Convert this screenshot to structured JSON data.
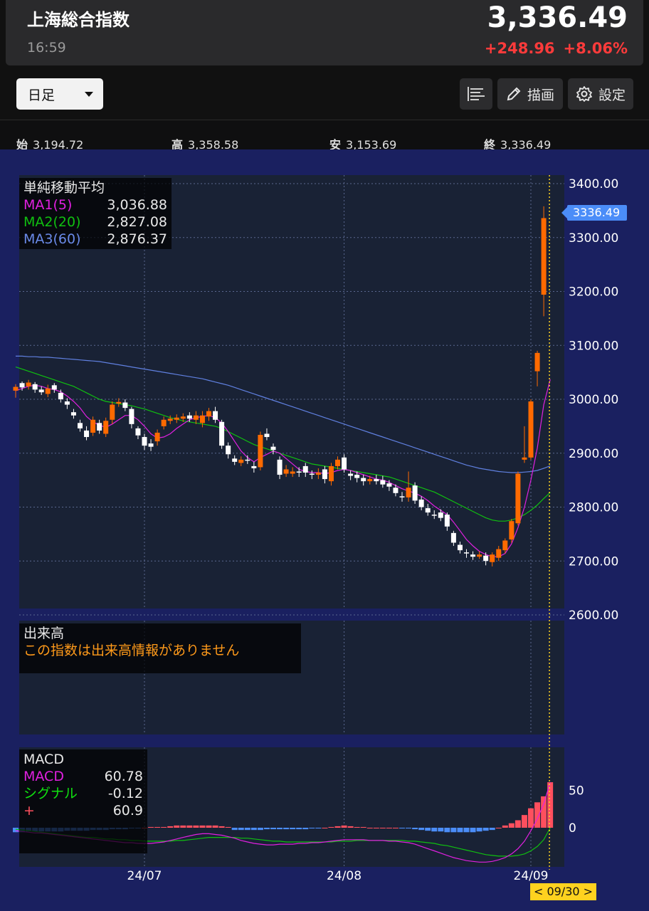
{
  "header": {
    "title": "上海総合指数",
    "time": "16:59",
    "price": "3,336.49",
    "change": "+248.96",
    "change_pct": "+8.06%"
  },
  "toolbar": {
    "period": "日足",
    "draw_label": "描画",
    "settings_label": "設定"
  },
  "ohlc": {
    "open_label": "始",
    "open": "3,194.72",
    "high_label": "高",
    "high": "3,358.58",
    "low_label": "安",
    "low": "3,153.69",
    "close_label": "終",
    "close": "3,336.49"
  },
  "ma_legend": {
    "title": "単純移動平均",
    "ma1_label": "MA1(5)",
    "ma1_value": "3,036.88",
    "ma2_label": "MA2(20)",
    "ma2_value": "2,827.08",
    "ma3_label": "MA3(60)",
    "ma3_value": "2,876.37"
  },
  "volume_legend": {
    "title": "出来高",
    "message": "この指数は出来高情報がありません"
  },
  "macd_legend": {
    "title": "MACD",
    "macd_label": "MACD",
    "macd_value": "60.78",
    "signal_label": "シグナル",
    "signal_value": "-0.12",
    "hist_label": "+",
    "hist_value": "60.9"
  },
  "current_price_tag": "3336.49",
  "date_tag": "< 09/30 >",
  "colors": {
    "up": "#ff6a00",
    "down": "#ffffff",
    "ma1": "#e020e0",
    "ma2": "#10c010",
    "ma3": "#6080e0",
    "macd_pos": "#ff4f5e",
    "macd_neg": "#4b8df8",
    "background": "#1a2060",
    "panel": "#192235"
  },
  "chart_data": {
    "type": "candlestick",
    "y_ticks": [
      "3400.00",
      "3300.00",
      "3200.00",
      "3100.00",
      "3000.00",
      "2900.00",
      "2800.00",
      "2700.00",
      "2600.00"
    ],
    "ylim": [
      2600,
      3400
    ],
    "x_ticks": [
      {
        "label": "24/07",
        "index": 20
      },
      {
        "label": "24/08",
        "index": 51
      },
      {
        "label": "24/09",
        "index": 80
      }
    ],
    "macd_ticks": [
      "50",
      "0"
    ],
    "candles": [
      [
        3016,
        3023,
        3028,
        3003
      ],
      [
        3030,
        3022,
        3033,
        3016
      ],
      [
        3024,
        3031,
        3036,
        3018
      ],
      [
        3028,
        3018,
        3032,
        3012
      ],
      [
        3018,
        3013,
        3024,
        3008
      ],
      [
        3010,
        3020,
        3027,
        3004
      ],
      [
        3026,
        3018,
        3030,
        3012
      ],
      [
        3012,
        3000,
        3018,
        2994
      ],
      [
        2996,
        2990,
        3002,
        2982
      ],
      [
        2976,
        2970,
        2982,
        2964
      ],
      [
        2956,
        2946,
        2962,
        2940
      ],
      [
        2942,
        2930,
        2950,
        2924
      ],
      [
        2938,
        2962,
        2968,
        2932
      ],
      [
        2956,
        2942,
        2962,
        2936
      ],
      [
        2936,
        2960,
        2966,
        2930
      ],
      [
        2962,
        2990,
        2996,
        2954
      ],
      [
        2992,
        2995,
        3002,
        2986
      ],
      [
        2994,
        2984,
        3000,
        2978
      ],
      [
        2982,
        2954,
        2986,
        2946
      ],
      [
        2946,
        2933,
        2950,
        2926
      ],
      [
        2930,
        2914,
        2936,
        2906
      ],
      [
        2918,
        2912,
        2926,
        2904
      ],
      [
        2922,
        2938,
        2944,
        2914
      ],
      [
        2950,
        2962,
        2968,
        2944
      ],
      [
        2960,
        2964,
        2970,
        2954
      ],
      [
        2962,
        2966,
        2972,
        2956
      ],
      [
        2964,
        2968,
        2974,
        2958
      ],
      [
        2970,
        2964,
        2976,
        2958
      ],
      [
        2962,
        2970,
        2978,
        2954
      ],
      [
        2956,
        2970,
        2978,
        2948
      ],
      [
        2968,
        2978,
        2984,
        2960
      ],
      [
        2978,
        2962,
        2986,
        2956
      ],
      [
        2958,
        2914,
        2962,
        2908
      ],
      [
        2914,
        2898,
        2920,
        2890
      ],
      [
        2890,
        2884,
        2896,
        2878
      ],
      [
        2882,
        2888,
        2894,
        2876
      ],
      [
        2888,
        2886,
        2896,
        2880
      ],
      [
        2876,
        2872,
        2884,
        2864
      ],
      [
        2874,
        2934,
        2940,
        2868
      ],
      [
        2936,
        2930,
        2946,
        2924
      ],
      [
        2912,
        2906,
        2918,
        2898
      ],
      [
        2888,
        2860,
        2894,
        2852
      ],
      [
        2862,
        2870,
        2878,
        2856
      ],
      [
        2862,
        2866,
        2874,
        2856
      ],
      [
        2866,
        2864,
        2874,
        2856
      ],
      [
        2876,
        2864,
        2882,
        2856
      ],
      [
        2862,
        2860,
        2868,
        2852
      ],
      [
        2860,
        2864,
        2872,
        2852
      ],
      [
        2870,
        2852,
        2876,
        2844
      ],
      [
        2848,
        2876,
        2882,
        2840
      ],
      [
        2876,
        2888,
        2894,
        2870
      ],
      [
        2892,
        2870,
        2898,
        2864
      ],
      [
        2862,
        2858,
        2868,
        2850
      ],
      [
        2860,
        2854,
        2866,
        2846
      ],
      [
        2854,
        2848,
        2860,
        2840
      ],
      [
        2848,
        2852,
        2858,
        2842
      ],
      [
        2852,
        2848,
        2860,
        2842
      ],
      [
        2850,
        2842,
        2858,
        2836
      ],
      [
        2844,
        2838,
        2850,
        2830
      ],
      [
        2836,
        2826,
        2842,
        2820
      ],
      [
        2820,
        2818,
        2828,
        2810
      ],
      [
        2818,
        2836,
        2866,
        2810
      ],
      [
        2840,
        2812,
        2846,
        2806
      ],
      [
        2814,
        2800,
        2820,
        2794
      ],
      [
        2798,
        2790,
        2806,
        2784
      ],
      [
        2786,
        2784,
        2794,
        2778
      ],
      [
        2790,
        2780,
        2796,
        2774
      ],
      [
        2786,
        2764,
        2790,
        2756
      ],
      [
        2752,
        2734,
        2756,
        2728
      ],
      [
        2730,
        2720,
        2736,
        2714
      ],
      [
        2716,
        2714,
        2722,
        2706
      ],
      [
        2712,
        2708,
        2718,
        2702
      ],
      [
        2708,
        2712,
        2718,
        2704
      ],
      [
        2710,
        2700,
        2716,
        2692
      ],
      [
        2698,
        2712,
        2716,
        2690
      ],
      [
        2706,
        2722,
        2728,
        2700
      ],
      [
        2720,
        2738,
        2742,
        2714
      ],
      [
        2740,
        2774,
        2778,
        2734
      ],
      [
        2770,
        2862,
        2866,
        2766
      ],
      [
        2888,
        2892,
        2950,
        2882
      ],
      [
        2892,
        2996,
        3000,
        2888
      ],
      [
        3052,
        3086,
        3090,
        3024
      ],
      [
        3194,
        3336,
        3358,
        3154
      ]
    ],
    "ma1": [
      3016,
      3020,
      3024,
      3026,
      3024,
      3020,
      3018,
      3014,
      3006,
      2996,
      2984,
      2968,
      2958,
      2952,
      2948,
      2954,
      2962,
      2970,
      2970,
      2962,
      2950,
      2936,
      2928,
      2930,
      2936,
      2946,
      2954,
      2962,
      2966,
      2968,
      2970,
      2966,
      2956,
      2940,
      2922,
      2904,
      2892,
      2884,
      2892,
      2898,
      2904,
      2900,
      2890,
      2880,
      2870,
      2866,
      2864,
      2864,
      2862,
      2864,
      2868,
      2870,
      2868,
      2864,
      2860,
      2856,
      2852,
      2850,
      2846,
      2840,
      2834,
      2830,
      2826,
      2820,
      2812,
      2802,
      2794,
      2786,
      2772,
      2756,
      2740,
      2728,
      2718,
      2712,
      2708,
      2708,
      2714,
      2732,
      2762,
      2800,
      2850,
      2910,
      2990,
      3036.88
    ],
    "ma2": [
      3060,
      3056,
      3052,
      3048,
      3044,
      3040,
      3036,
      3032,
      3028,
      3024,
      3018,
      3012,
      3006,
      3000,
      2996,
      2994,
      2992,
      2990,
      2988,
      2985,
      2982,
      2978,
      2974,
      2970,
      2966,
      2963,
      2960,
      2958,
      2956,
      2954,
      2952,
      2950,
      2946,
      2940,
      2934,
      2928,
      2922,
      2916,
      2912,
      2908,
      2904,
      2900,
      2896,
      2892,
      2888,
      2884,
      2880,
      2878,
      2876,
      2874,
      2872,
      2870,
      2868,
      2866,
      2864,
      2862,
      2860,
      2858,
      2856,
      2852,
      2848,
      2844,
      2840,
      2836,
      2832,
      2828,
      2822,
      2816,
      2810,
      2804,
      2798,
      2792,
      2786,
      2780,
      2776,
      2774,
      2774,
      2776,
      2780,
      2786,
      2794,
      2804,
      2816,
      2827.08
    ],
    "ma3": [
      3080,
      3080,
      3079,
      3079,
      3078,
      3078,
      3077,
      3076,
      3075,
      3074,
      3073,
      3072,
      3071,
      3070,
      3068,
      3066,
      3064,
      3062,
      3060,
      3058,
      3056,
      3054,
      3052,
      3050,
      3048,
      3046,
      3044,
      3042,
      3040,
      3038,
      3035,
      3032,
      3029,
      3026,
      3022,
      3018,
      3014,
      3010,
      3006,
      3002,
      2998,
      2994,
      2990,
      2986,
      2982,
      2978,
      2974,
      2970,
      2966,
      2962,
      2958,
      2954,
      2950,
      2946,
      2942,
      2938,
      2934,
      2930,
      2926,
      2922,
      2918,
      2914,
      2910,
      2906,
      2902,
      2898,
      2894,
      2890,
      2886,
      2882,
      2878,
      2875,
      2872,
      2870,
      2868,
      2866,
      2865,
      2864,
      2864,
      2865,
      2866,
      2868,
      2872,
      2876.37
    ],
    "macd_hist": [
      -6,
      -6,
      -5,
      -5,
      -5,
      -5,
      -5,
      -5,
      -4,
      -4,
      -4,
      -4,
      -3,
      -3,
      -3,
      -2,
      -2,
      -2,
      -1,
      -1,
      0,
      1,
      1,
      1,
      2,
      3,
      3,
      3,
      3,
      3,
      3,
      3,
      2,
      1,
      -3,
      -3,
      -3,
      -3,
      -3,
      -2,
      -2,
      -2,
      -2,
      -2,
      -2,
      -2,
      -1,
      -1,
      0,
      1,
      2,
      3,
      2,
      1,
      1,
      0,
      0,
      0,
      0,
      0,
      -1,
      -1,
      -2,
      -3,
      -4,
      -5,
      -5,
      -6,
      -6,
      -6,
      -6,
      -6,
      -5,
      -4,
      -3,
      0,
      3,
      6,
      10,
      17,
      26,
      34,
      42,
      60.9
    ],
    "macd_line": [
      -4,
      -5,
      -6,
      -7,
      -7,
      -8,
      -9,
      -10,
      -11,
      -12,
      -13,
      -14,
      -15,
      -16,
      -17,
      -18,
      -19,
      -20,
      -20,
      -21,
      -21,
      -21,
      -20,
      -19,
      -17,
      -15,
      -13,
      -11,
      -9,
      -8,
      -8,
      -9,
      -10,
      -12,
      -14,
      -17,
      -19,
      -21,
      -22,
      -23,
      -23,
      -22,
      -22,
      -22,
      -21,
      -21,
      -20,
      -20,
      -19,
      -18,
      -17,
      -16,
      -16,
      -16,
      -16,
      -17,
      -17,
      -17,
      -18,
      -18,
      -19,
      -20,
      -22,
      -25,
      -28,
      -31,
      -34,
      -37,
      -40,
      -42,
      -44,
      -45,
      -46,
      -46,
      -45,
      -43,
      -40,
      -35,
      -28,
      -18,
      -4,
      12,
      32,
      60.78
    ],
    "signal_line": [
      -2,
      -3,
      -4,
      -5,
      -6,
      -7,
      -8,
      -9,
      -10,
      -11,
      -12,
      -13,
      -13,
      -14,
      -15,
      -15,
      -16,
      -16,
      -17,
      -17,
      -18,
      -18,
      -18,
      -18,
      -18,
      -17,
      -17,
      -16,
      -15,
      -14,
      -13,
      -13,
      -13,
      -13,
      -13,
      -14,
      -14,
      -15,
      -16,
      -17,
      -18,
      -18,
      -19,
      -19,
      -19,
      -19,
      -19,
      -19,
      -19,
      -19,
      -18,
      -18,
      -18,
      -17,
      -17,
      -17,
      -17,
      -17,
      -17,
      -17,
      -17,
      -18,
      -18,
      -19,
      -20,
      -21,
      -23,
      -24,
      -26,
      -28,
      -30,
      -32,
      -34,
      -36,
      -37,
      -38,
      -38,
      -38,
      -37,
      -35,
      -31,
      -25,
      -16,
      -0.12
    ]
  }
}
